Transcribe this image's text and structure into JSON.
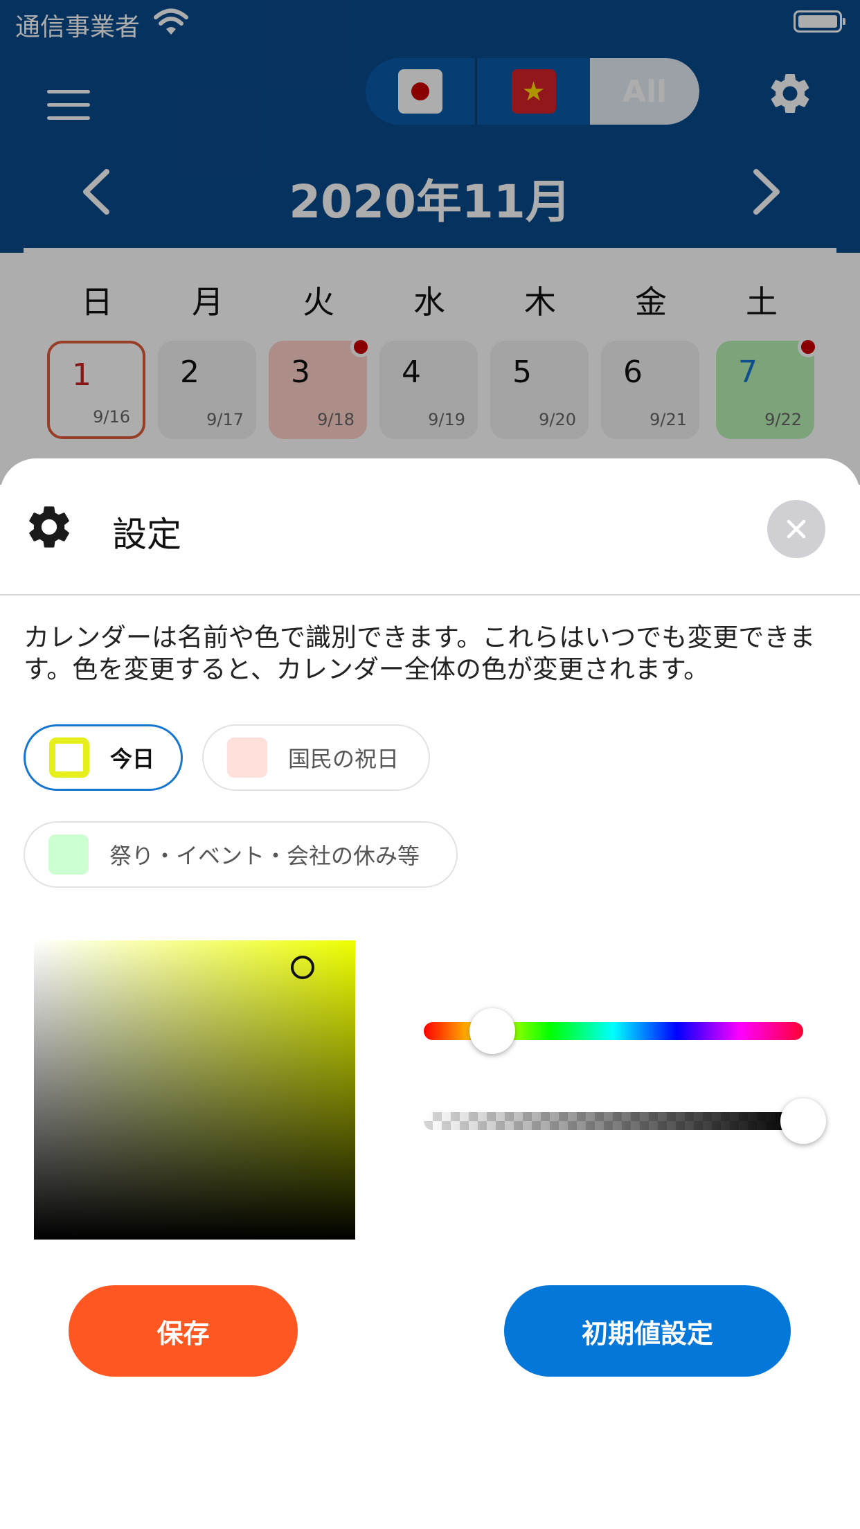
{
  "status_bar": {
    "carrier": "通信事業者",
    "wifi_icon": "wifi-icon",
    "battery_icon": "battery-icon"
  },
  "header": {
    "menu_icon": "hamburger-icon",
    "flags": [
      {
        "name": "japan-flag-icon",
        "selected": false
      },
      {
        "name": "vietnam-flag-icon",
        "selected": false
      }
    ],
    "all_label": "All",
    "settings_icon": "gear-icon",
    "month_title": "2020年11月",
    "prev_icon": "chevron-left-icon",
    "next_icon": "chevron-right-icon"
  },
  "calendar": {
    "weekdays": [
      "日",
      "月",
      "火",
      "水",
      "木",
      "金",
      "土"
    ],
    "days": [
      {
        "day": "1",
        "sub": "9/16",
        "style": "today",
        "dot": false
      },
      {
        "day": "2",
        "sub": "9/17",
        "style": "normal",
        "dot": false
      },
      {
        "day": "3",
        "sub": "9/18",
        "style": "holiday",
        "dot": true
      },
      {
        "day": "4",
        "sub": "9/19",
        "style": "normal",
        "dot": false
      },
      {
        "day": "5",
        "sub": "9/20",
        "style": "normal",
        "dot": false
      },
      {
        "day": "6",
        "sub": "9/21",
        "style": "normal",
        "dot": false
      },
      {
        "day": "7",
        "sub": "9/22",
        "style": "event",
        "dot": true
      }
    ]
  },
  "sheet": {
    "title": "設定",
    "title_icon": "gear-icon",
    "close_icon": "close-icon",
    "description": "カレンダーは名前や色で識別できます。これらはいつでも変更できます。色を変更すると、カレンダー全体の色が変更されます。",
    "chips": [
      {
        "label": "今日",
        "color": "#e6ef1c",
        "selected": true
      },
      {
        "label": "国民の祝日",
        "color": "#ffe0da",
        "selected": false
      },
      {
        "label": "祭り・イベント・会社の休み等",
        "color": "#ccffd2",
        "selected": false
      }
    ],
    "picker": {
      "hue_position": 0.18,
      "alpha_position": 1.0
    },
    "save_label": "保存",
    "reset_label": "初期値設定"
  },
  "colors": {
    "header_bg": "#0a4a8c",
    "save_button": "#ff5722",
    "reset_button": "#0477d8",
    "today_border": "#e05a3a",
    "holiday_bg": "#ffd0c8",
    "event_bg": "#b8f0b4",
    "selected_chip_border": "#1576d2"
  }
}
